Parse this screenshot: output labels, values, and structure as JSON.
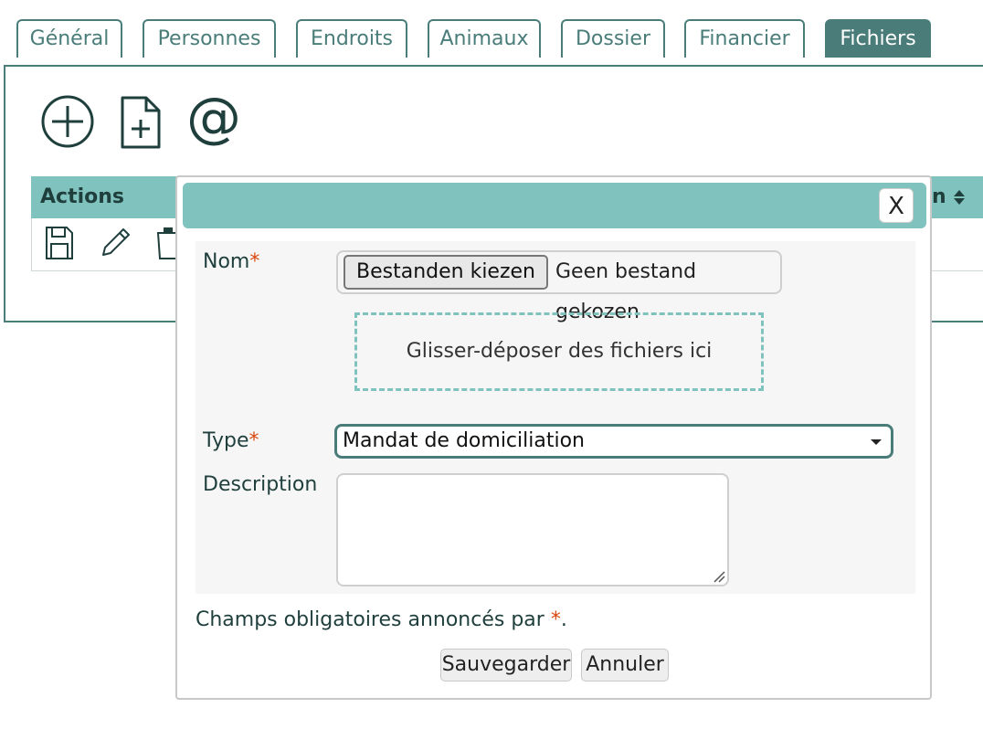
{
  "tabs": [
    {
      "label": "Général"
    },
    {
      "label": "Personnes"
    },
    {
      "label": "Endroits"
    },
    {
      "label": "Animaux"
    },
    {
      "label": "Dossier"
    },
    {
      "label": "Financier"
    },
    {
      "label": "Fichiers",
      "active": true
    }
  ],
  "toolbar": {
    "icons": [
      "add-circle-icon",
      "new-document-icon",
      "email-at-icon"
    ]
  },
  "grid": {
    "header_actions": "Actions",
    "header_right": "n",
    "row_icons": [
      "save-icon",
      "edit-pencil-icon",
      "trash-icon"
    ]
  },
  "dialog": {
    "close_label": "X",
    "name_label": "Nom",
    "required_mark": "*",
    "file_button": "Bestanden kiezen",
    "file_status": "Geen bestand gekozen",
    "dropzone": "Glisser-déposer des fichiers ici",
    "type_label": "Type",
    "type_value": "Mandat de domiciliation",
    "description_label": "Description",
    "description_value": "",
    "required_note": "Champs obligatoires annoncés par",
    "required_note_end": ".",
    "save_button": "Sauvegarder",
    "cancel_button": "Annuler"
  },
  "colors": {
    "primary": "#4a7d7a",
    "header_bg": "#80c2bd",
    "required": "#d9480f"
  }
}
